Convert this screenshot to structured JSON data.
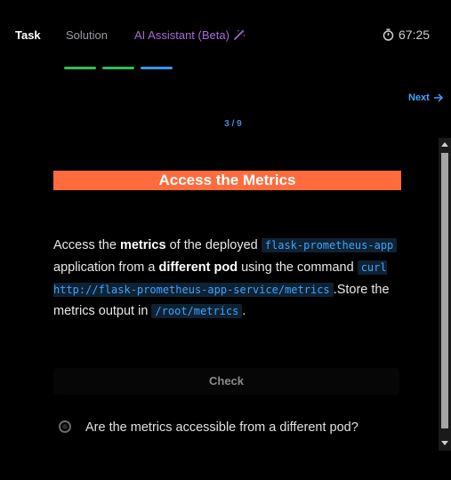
{
  "tabs": {
    "task": "Task",
    "solution": "Solution",
    "ai_assistant": "AI Assistant (Beta)"
  },
  "timer": "67:25",
  "progress": {
    "segments": [
      {
        "color": "#2fbf5b"
      },
      {
        "color": "#2fbf5b"
      },
      {
        "color": "#3a96f0"
      }
    ]
  },
  "next_label": "Next",
  "counter": "3 / 9",
  "task": {
    "title": "Access the Metrics",
    "text_1": "Access the ",
    "bold_1": "metrics",
    "text_2": " of the deployed ",
    "code_1": "flask-prometheus-app",
    "text_3": " application from a ",
    "bold_2": "different pod",
    "text_4": " using the command ",
    "code_2": "curl http://flask-prometheus-app-service/metrics",
    "text_5": ".Store the metrics output in ",
    "code_3": "/root/metrics",
    "text_6": "."
  },
  "check_label": "Check",
  "checklist": [
    {
      "label": "Are the metrics accessible from a different pod?"
    }
  ],
  "colors": {
    "title_bg": "#ff6b3d",
    "accent_blue": "#3ea4ff",
    "ai_purple": "#a86ad8"
  }
}
